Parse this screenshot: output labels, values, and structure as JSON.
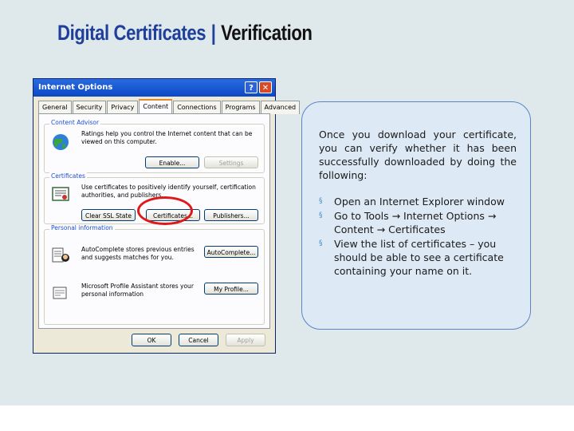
{
  "slide": {
    "title_part1": "Digital Certificates",
    "title_sep": "|",
    "title_part2": "Verification"
  },
  "dialog": {
    "title": "Internet Options",
    "help_btn": "?",
    "close_btn": "✕",
    "tabs": [
      "General",
      "Security",
      "Privacy",
      "Content",
      "Connections",
      "Programs",
      "Advanced"
    ],
    "active_tab": "Content",
    "content_advisor": {
      "label": "Content Advisor",
      "text": "Ratings help you control the Internet content that can be viewed on this computer.",
      "enable_btn": "Enable...",
      "settings_btn": "Settings"
    },
    "certificates": {
      "label": "Certificates",
      "text": "Use certificates to positively identify yourself, certification authorities, and publishers.",
      "clear_ssl_btn": "Clear SSL State",
      "certificates_btn": "Certificates...",
      "publishers_btn": "Publishers..."
    },
    "personal_info": {
      "label": "Personal information",
      "autocomplete_text": "AutoComplete stores previous entries and suggests matches for you.",
      "autocomplete_btn": "AutoComplete...",
      "profile_text": "Microsoft Profile Assistant stores your personal information",
      "profile_btn": "My Profile..."
    },
    "ok_btn": "OK",
    "cancel_btn": "Cancel",
    "apply_btn": "Apply"
  },
  "callout": {
    "intro": "Once you download your certificate, you can verify whether it has been successfully downloaded by doing the following:",
    "bullet_mark": "§",
    "bullets": [
      "Open an Internet Explorer window",
      "Go to Tools → Internet Options → Content → Certificates",
      "View the list of certificates – you should be able to see a certificate containing your name on it."
    ]
  },
  "colors": {
    "background": "#dfe9ec",
    "title_blue": "#1f3f9a",
    "callout_fill": "#dde9f4",
    "callout_border": "#5b84c6",
    "highlight_red": "#e01818"
  }
}
